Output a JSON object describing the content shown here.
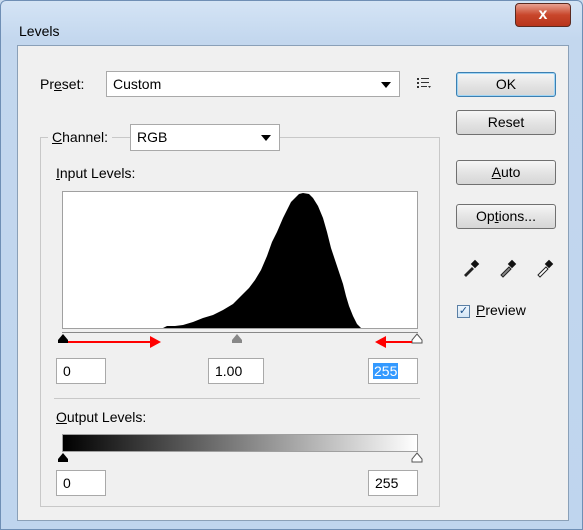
{
  "window": {
    "title": "Levels",
    "close_glyph": "x"
  },
  "preset": {
    "label_pre": "Pr",
    "label_u": "e",
    "label_post": "set:",
    "value": "Custom",
    "menu_icon": "preset-options-icon"
  },
  "channel": {
    "label_u": "C",
    "label_post": "hannel:",
    "value": "RGB"
  },
  "input_levels": {
    "label_u": "I",
    "label_post": "nput Levels:",
    "black": "0",
    "gamma": "1.00",
    "white": "255"
  },
  "output_levels": {
    "label_u": "O",
    "label_post": "utput Levels:",
    "black": "0",
    "white": "255"
  },
  "buttons": {
    "ok": "OK",
    "reset": "Reset",
    "auto_u": "A",
    "auto_post": "uto",
    "options_pre": "Op",
    "options_u": "t",
    "options_post": "ions..."
  },
  "preview": {
    "label_u": "P",
    "label_post": "review",
    "checked": true,
    "check_glyph": "✓"
  },
  "eyedroppers": [
    "black-point-eyedropper-icon",
    "gray-point-eyedropper-icon",
    "white-point-eyedropper-icon"
  ],
  "annotation_color": "#ff0000"
}
